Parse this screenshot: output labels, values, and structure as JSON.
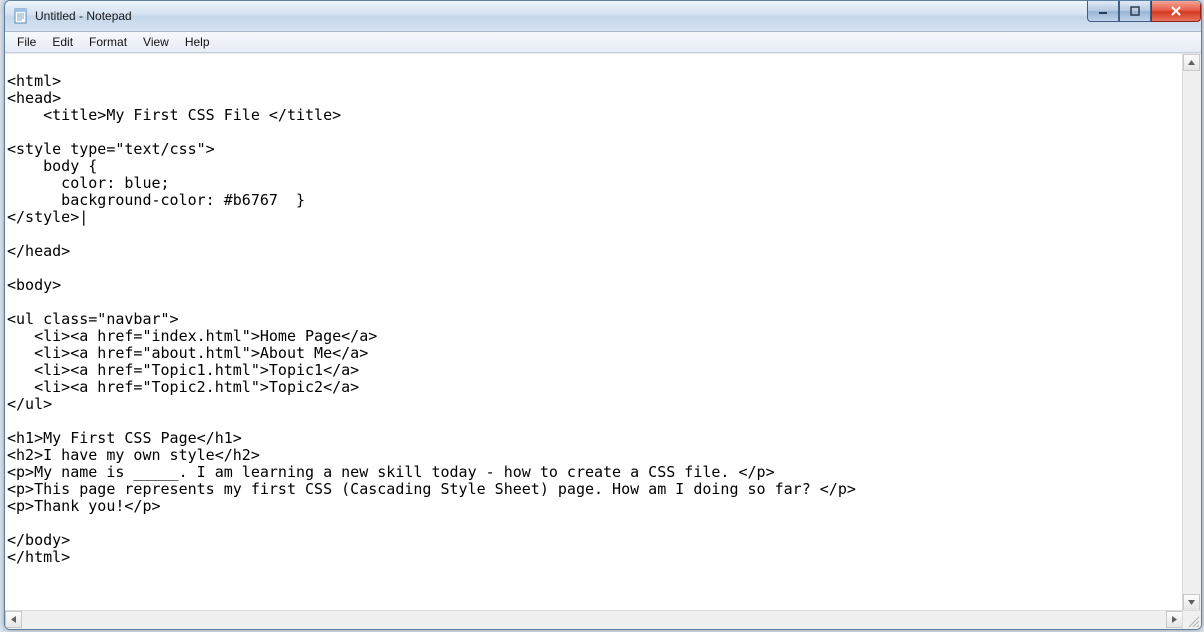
{
  "window": {
    "title": "Untitled - Notepad"
  },
  "menu": {
    "items": [
      "File",
      "Edit",
      "Format",
      "View",
      "Help"
    ]
  },
  "editor": {
    "content": "\n<html>\n<head>\n    <title>My First CSS File </title>\n\n<style type=\"text/css\">\n    body {\n      color: blue;\n      background-color: #b6767  }\n</style>|\n\n</head>\n\n<body>\n\n<ul class=\"navbar\">\n   <li><a href=\"index.html\">Home Page</a>\n   <li><a href=\"about.html\">About Me</a>\n   <li><a href=\"Topic1.html\">Topic1</a>\n   <li><a href=\"Topic2.html\">Topic2</a>\n</ul>\n\n<h1>My First CSS Page</h1>\n<h2>I have my own style</h2>\n<p>My name is _____. I am learning a new skill today - how to create a CSS file. </p>\n<p>This page represents my first CSS (Cascading Style Sheet) page. How am I doing so far? </p>\n<p>Thank you!</p>\n\n</body>\n</html>"
  }
}
